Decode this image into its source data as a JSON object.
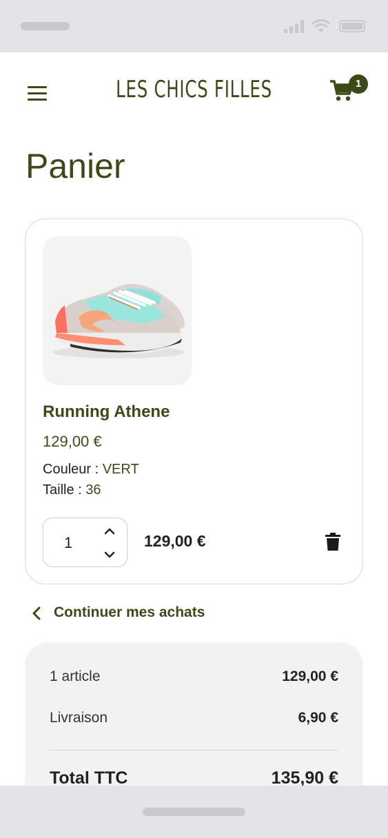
{
  "header": {
    "brand": "LES CHICS FILLES",
    "cart_count": "1"
  },
  "page": {
    "title": "Panier"
  },
  "cart_item": {
    "name": "Running Athene",
    "price": "129,00 €",
    "color_label": "Couleur :",
    "color_value": "VERT",
    "size_label": "Taille :",
    "size_value": "36",
    "quantity": "1",
    "line_total": "129,00 €"
  },
  "continue_shopping": {
    "label": "Continuer mes achats"
  },
  "summary": {
    "articles_label": "1 article",
    "articles_value": "129,00 €",
    "shipping_label": "Livraison",
    "shipping_value": "6,90 €",
    "total_label": "Total TTC",
    "total_value": "135,90 €"
  },
  "colors": {
    "brand": "#3d4a18",
    "status_bar": "#e4e3ea"
  },
  "icons": [
    "signal-icon",
    "wifi-icon",
    "battery-icon",
    "menu-icon",
    "cart-icon",
    "chevron-up-icon",
    "chevron-down-icon",
    "trash-icon",
    "chevron-left-icon"
  ]
}
